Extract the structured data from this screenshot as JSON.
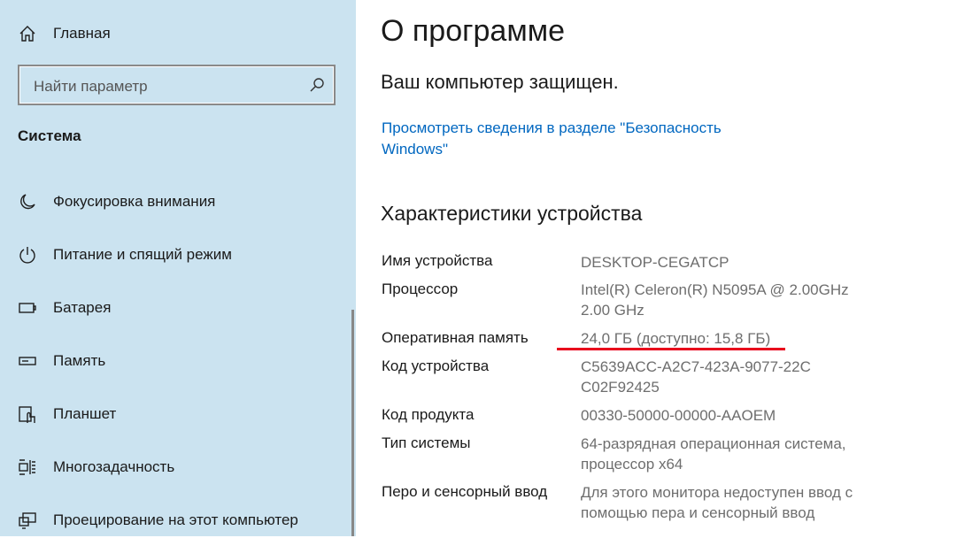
{
  "sidebar": {
    "home_label": "Главная",
    "search_placeholder": "Найти параметр",
    "section_title": "Система",
    "items": [
      {
        "label": "Фокусировка внимания",
        "icon": "moon-icon"
      },
      {
        "label": "Питание и спящий режим",
        "icon": "power-icon"
      },
      {
        "label": "Батарея",
        "icon": "battery-icon"
      },
      {
        "label": "Память",
        "icon": "storage-icon"
      },
      {
        "label": "Планшет",
        "icon": "tablet-icon"
      },
      {
        "label": "Многозадачность",
        "icon": "multitasking-icon"
      },
      {
        "label": "Проецирование на этот компьютер",
        "icon": "projecting-icon"
      }
    ]
  },
  "main": {
    "title": "О программе",
    "protection_status": "Ваш компьютер защищен.",
    "security_link": "Просмотреть сведения в разделе \"Безопасность Windows\"",
    "specs_title": "Характеристики устройства",
    "specs": [
      {
        "label": "Имя устройства",
        "value": "DESKTOP-CEGATCP"
      },
      {
        "label": "Процессор",
        "value": "Intel(R) Celeron(R) N5095A @ 2.00GHz 2.00 GHz"
      },
      {
        "label": "Оперативная память",
        "value": "24,0 ГБ (доступно: 15,8 ГБ)"
      },
      {
        "label": "Код устройства",
        "value": "C5639ACC-A2C7-423A-9077-22CC02F92425"
      },
      {
        "label": "Код продукта",
        "value": "00330-50000-00000-AAOEM"
      },
      {
        "label": "Тип системы",
        "value": "64-разрядная операционная система, процессор x64"
      },
      {
        "label": "Перо и сенсорный ввод",
        "value": "Для этого монитора недоступен ввод с помощью пера и сенсорный ввод"
      }
    ]
  },
  "colors": {
    "sidebar_bg": "#cbe3f0",
    "link": "#0067c0",
    "annotation_underline": "#e8001c"
  }
}
